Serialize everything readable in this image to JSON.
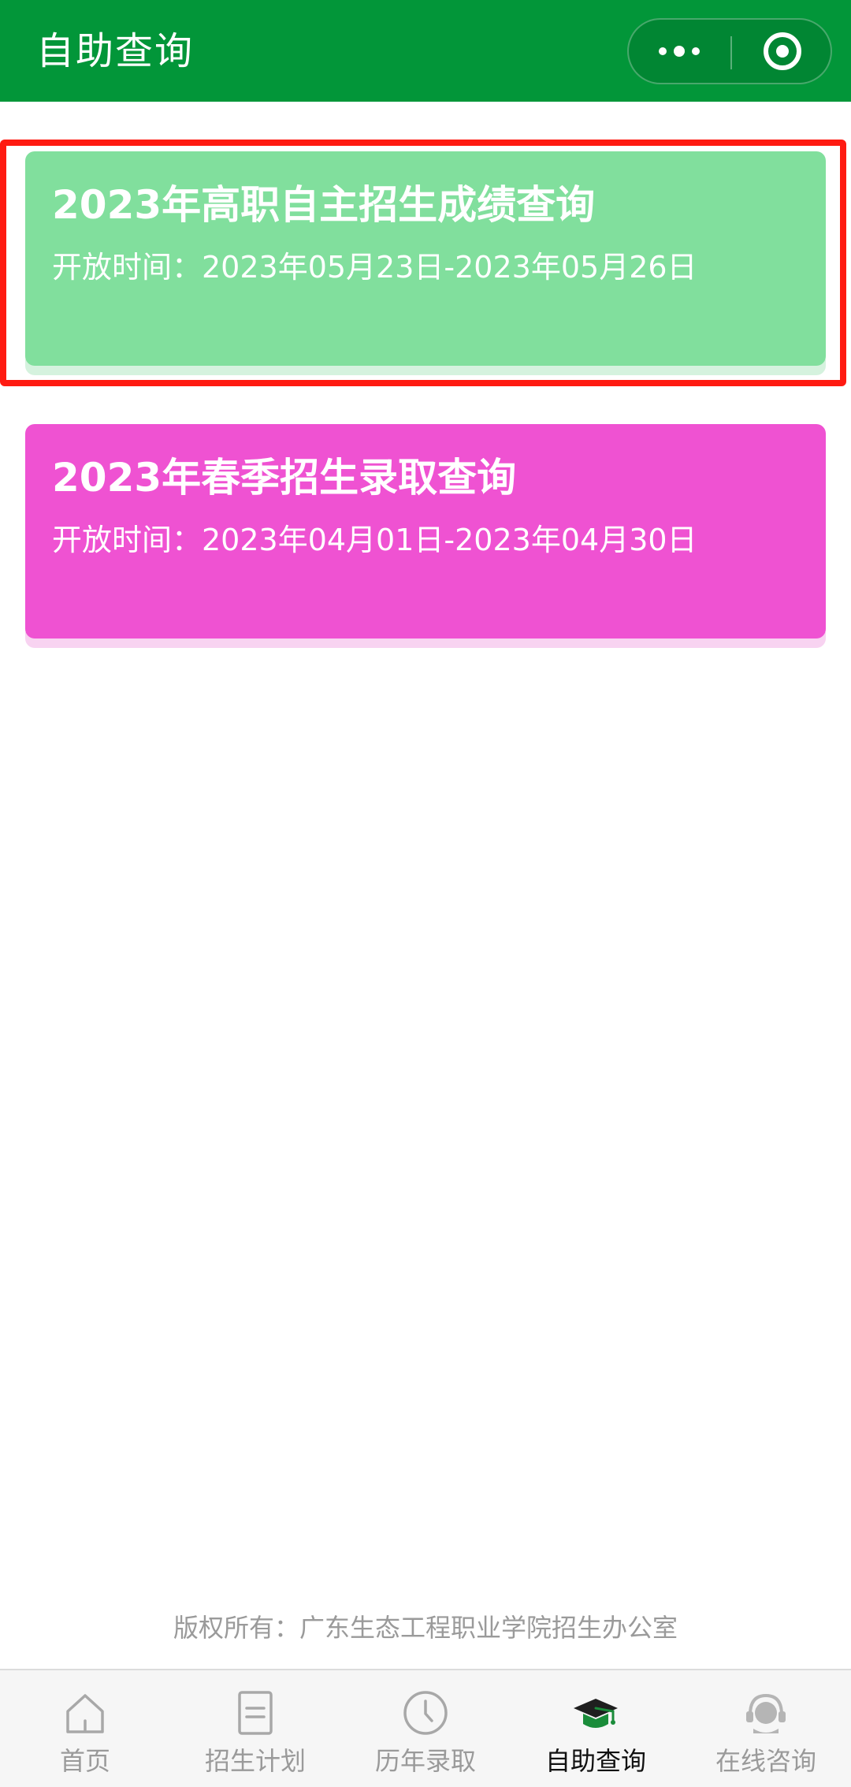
{
  "header": {
    "title": "自助查询",
    "more_icon": "more-dots-icon",
    "close_icon": "target-circle-icon"
  },
  "cards": [
    {
      "title": "2023年高职自主招生成绩查询",
      "time": "开放时间：2023年05月23日-2023年05月26日",
      "color": "#81df9d",
      "highlighted": true
    },
    {
      "title": "2023年春季招生录取查询",
      "time": "开放时间：2023年04月01日-2023年04月30日",
      "color": "#ef52d2",
      "highlighted": false
    }
  ],
  "footer": {
    "copyright": "版权所有：广东生态工程职业学院招生办公室"
  },
  "tabbar": {
    "active_index": 3,
    "items": [
      {
        "label": "首页",
        "icon": "home-icon"
      },
      {
        "label": "招生计划",
        "icon": "document-icon"
      },
      {
        "label": "历年录取",
        "icon": "clock-icon"
      },
      {
        "label": "自助查询",
        "icon": "graduation-cap-icon"
      },
      {
        "label": "在线咨询",
        "icon": "headset-icon"
      }
    ]
  },
  "colors": {
    "header_bg": "#029639",
    "highlight": "#ff1b12",
    "tab_active": "#111111",
    "tab_inactive": "#9a9a9a"
  }
}
